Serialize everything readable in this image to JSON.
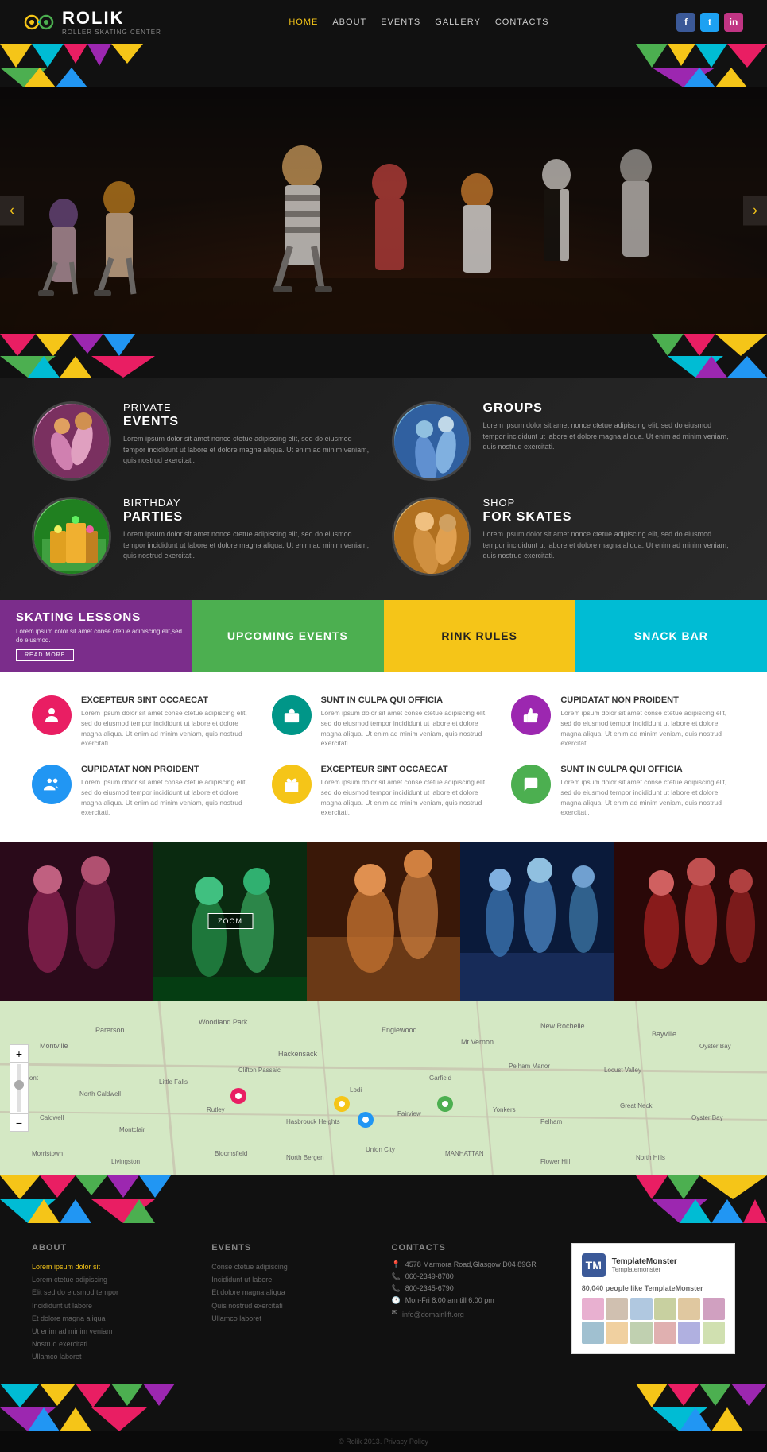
{
  "brand": {
    "name": "ROLIK",
    "subtitle": "ROLLER SKATING CENTER",
    "logo_color1": "#f5c518",
    "logo_color2": "#4caf50",
    "logo_color3": "#00bcd4"
  },
  "nav": {
    "links": [
      {
        "label": "HOME",
        "active": true
      },
      {
        "label": "ABOUT",
        "active": false
      },
      {
        "label": "EVENTS",
        "active": false
      },
      {
        "label": "GALLERY",
        "active": false
      },
      {
        "label": "CONTACTS",
        "active": false
      }
    ]
  },
  "social": {
    "fb_color": "#3b5998",
    "tw_color": "#1da1f2",
    "in_color": "#c13584"
  },
  "services": [
    {
      "eyebrow": "PRIVATE",
      "title": "EVENTS",
      "description": "Lorem ipsum dolor sit amet nonce ctetue adipiscing elit, sed do eiusmod tempor incididunt ut labore et dolore magna aliqua. Ut enim ad minim veniam, quis nostrud exercitati."
    },
    {
      "eyebrow": "GROUPS",
      "title": "",
      "description": "Lorem ipsum dolor sit amet nonce ctetue adipiscing elit, sed do eiusmod tempor incididunt ut labore et dolore magna aliqua. Ut enim ad minim veniam, quis nostrud exercitati."
    },
    {
      "eyebrow": "BIRTHDAY",
      "title": "PARTIES",
      "description": "Lorem ipsum dolor sit amet nonce ctetue adipiscing elit, sed do eiusmod tempor incididunt ut labore et dolore magna aliqua. Ut enim ad minim veniam, quis nostrud exercitati."
    },
    {
      "eyebrow": "SHOP",
      "title": "FOR SKATES",
      "description": "Lorem ipsum dolor sit amet nonce ctetue adipiscing elit, sed do eiusmod tempor incididunt ut labore et dolore magna aliqua. Ut enim ad minim veniam, quis nostrud exercitati."
    }
  ],
  "bands": [
    {
      "label": "SKATING LESSONS",
      "description": "Lorem ipsum color sit amet conse ctetue adipiscing elit,sed do eiusmod.",
      "button": "READ MORE",
      "color": "#7b2d8b"
    },
    {
      "label": "UPCOMING EVENTS",
      "description": "",
      "button": "",
      "color": "#4caf50"
    },
    {
      "label": "RINK RULES",
      "description": "",
      "button": "",
      "color": "#f5c518"
    },
    {
      "label": "SNACK BAR",
      "description": "",
      "button": "",
      "color": "#00bcd4"
    }
  ],
  "features": [
    {
      "icon": "👤",
      "color": "#e91e63",
      "title": "EXCEPTEUR SINT OCCAECAT",
      "description": "Lorem ipsum dolor sit amet conse ctetue adipiscing elit, sed do eiusmod tempor incididunt ut labore et dolore magna aliqua. Ut enim ad minim veniam, quis nostrud exercitati."
    },
    {
      "icon": "🧳",
      "color": "#009688",
      "title": "SUNT IN CULPA QUI OFFICIA",
      "description": "Lorem ipsum dolor sit amet conse ctetue adipiscing elit, sed do eiusmod tempor incididunt ut labore et dolore magna aliqua. Ut enim ad minim veniam, quis nostrud exercitati."
    },
    {
      "icon": "👍",
      "color": "#9c27b0",
      "title": "CUPIDATAT NON PROIDENT",
      "description": "Lorem ipsum dolor sit amet conse ctetue adipiscing elit, sed do eiusmod tempor incididunt ut labore et dolore magna aliqua. Ut enim ad minim veniam, quis nostrud exercitati."
    },
    {
      "icon": "👥",
      "color": "#2196f3",
      "title": "CUPIDATAT NON PROIDENT",
      "description": "Lorem ipsum dolor sit amet conse ctetue adipiscing elit, sed do eiusmod tempor incididunt ut labore et dolore magna aliqua. Ut enim ad minim veniam, quis nostrud exercitati."
    },
    {
      "icon": "🎁",
      "color": "#f5c518",
      "title": "EXCEPTEUR SINT OCCAECAT",
      "description": "Lorem ipsum dolor sit amet conse ctetue adipiscing elit, sed do eiusmod tempor incididunt ut labore et dolore magna aliqua. Ut enim ad minim veniam, quis nostrud exercitati."
    },
    {
      "icon": "💬",
      "color": "#4caf50",
      "title": "SUNT IN CULPA QUI OFFICIA",
      "description": "Lorem ipsum dolor sit amet conse ctetue adipiscing elit, sed do eiusmod tempor incididunt ut labore et dolore magna aliqua. Ut enim ad minim veniam, quis nostrud exercitati."
    }
  ],
  "gallery": {
    "zoom_label": "ZOOM",
    "images": [
      {
        "bg": "#3a1a2a"
      },
      {
        "bg": "#1a3a1a"
      },
      {
        "bg": "#4a2a1a"
      },
      {
        "bg": "#1a2a3a"
      },
      {
        "bg": "#3a1a1a"
      }
    ]
  },
  "footer": {
    "about_title": "ABOUT",
    "about_link": "Lorem ipsum dolor sit",
    "about_items": [
      "Lorem ctetue adipiscing",
      "Elit sed do eiusmod tempor",
      "Incididunt ut labore",
      "Et dolore magna aliqua",
      "Ut enim ad minim veniam",
      "Nostrud exercitati",
      "Ullamco laboret"
    ],
    "events_title": "EVENTS",
    "events_items": [
      "Conse ctetue adipiscing",
      "Incididunt ut labore",
      "Et dolore magna aliqua",
      "Quis nostrud exercitati",
      "Ullamco laboret"
    ],
    "contacts_title": "CONTACTS",
    "address": "4578 Marmora Road,Glasgow D04 89GR",
    "phone1": "060-2349-8780",
    "phone2": "800-2345-6790",
    "hours": "Mon-Fri 8:00 am till 6:00 pm",
    "email": "info@domainlift.org",
    "social_widget": {
      "name": "TemplateMonster",
      "count": "80,040 people like TemplateMonster",
      "likes_label": "people like TemplateMonster"
    }
  },
  "copyright": "© Rolik 2013. Privacy Policy"
}
